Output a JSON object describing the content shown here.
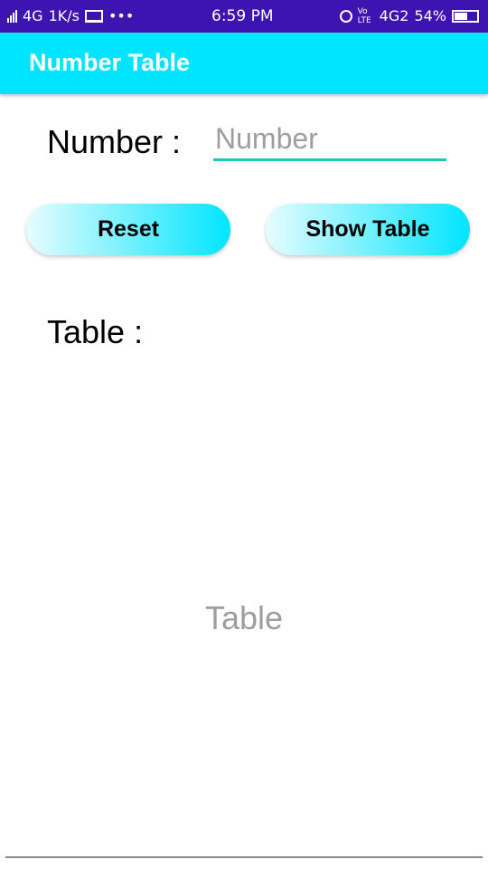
{
  "status_bar": {
    "network_left": "4G",
    "speed": "1K/s",
    "more": "•••",
    "time": "6:59 PM",
    "volte": "Vo LTE",
    "network_right": "4G2",
    "battery_percent": "54%"
  },
  "app_bar": {
    "title": "Number Table"
  },
  "form": {
    "number_label": "Number :",
    "number_input_value": "",
    "number_input_placeholder": "Number",
    "reset_label": "Reset",
    "show_table_label": "Show Table",
    "table_label": "Table  :",
    "table_placeholder": "Table"
  },
  "colors": {
    "status_bar": "#3e14b1",
    "app_bar": "#00e5ff",
    "input_underline": "#1fc7b7"
  }
}
